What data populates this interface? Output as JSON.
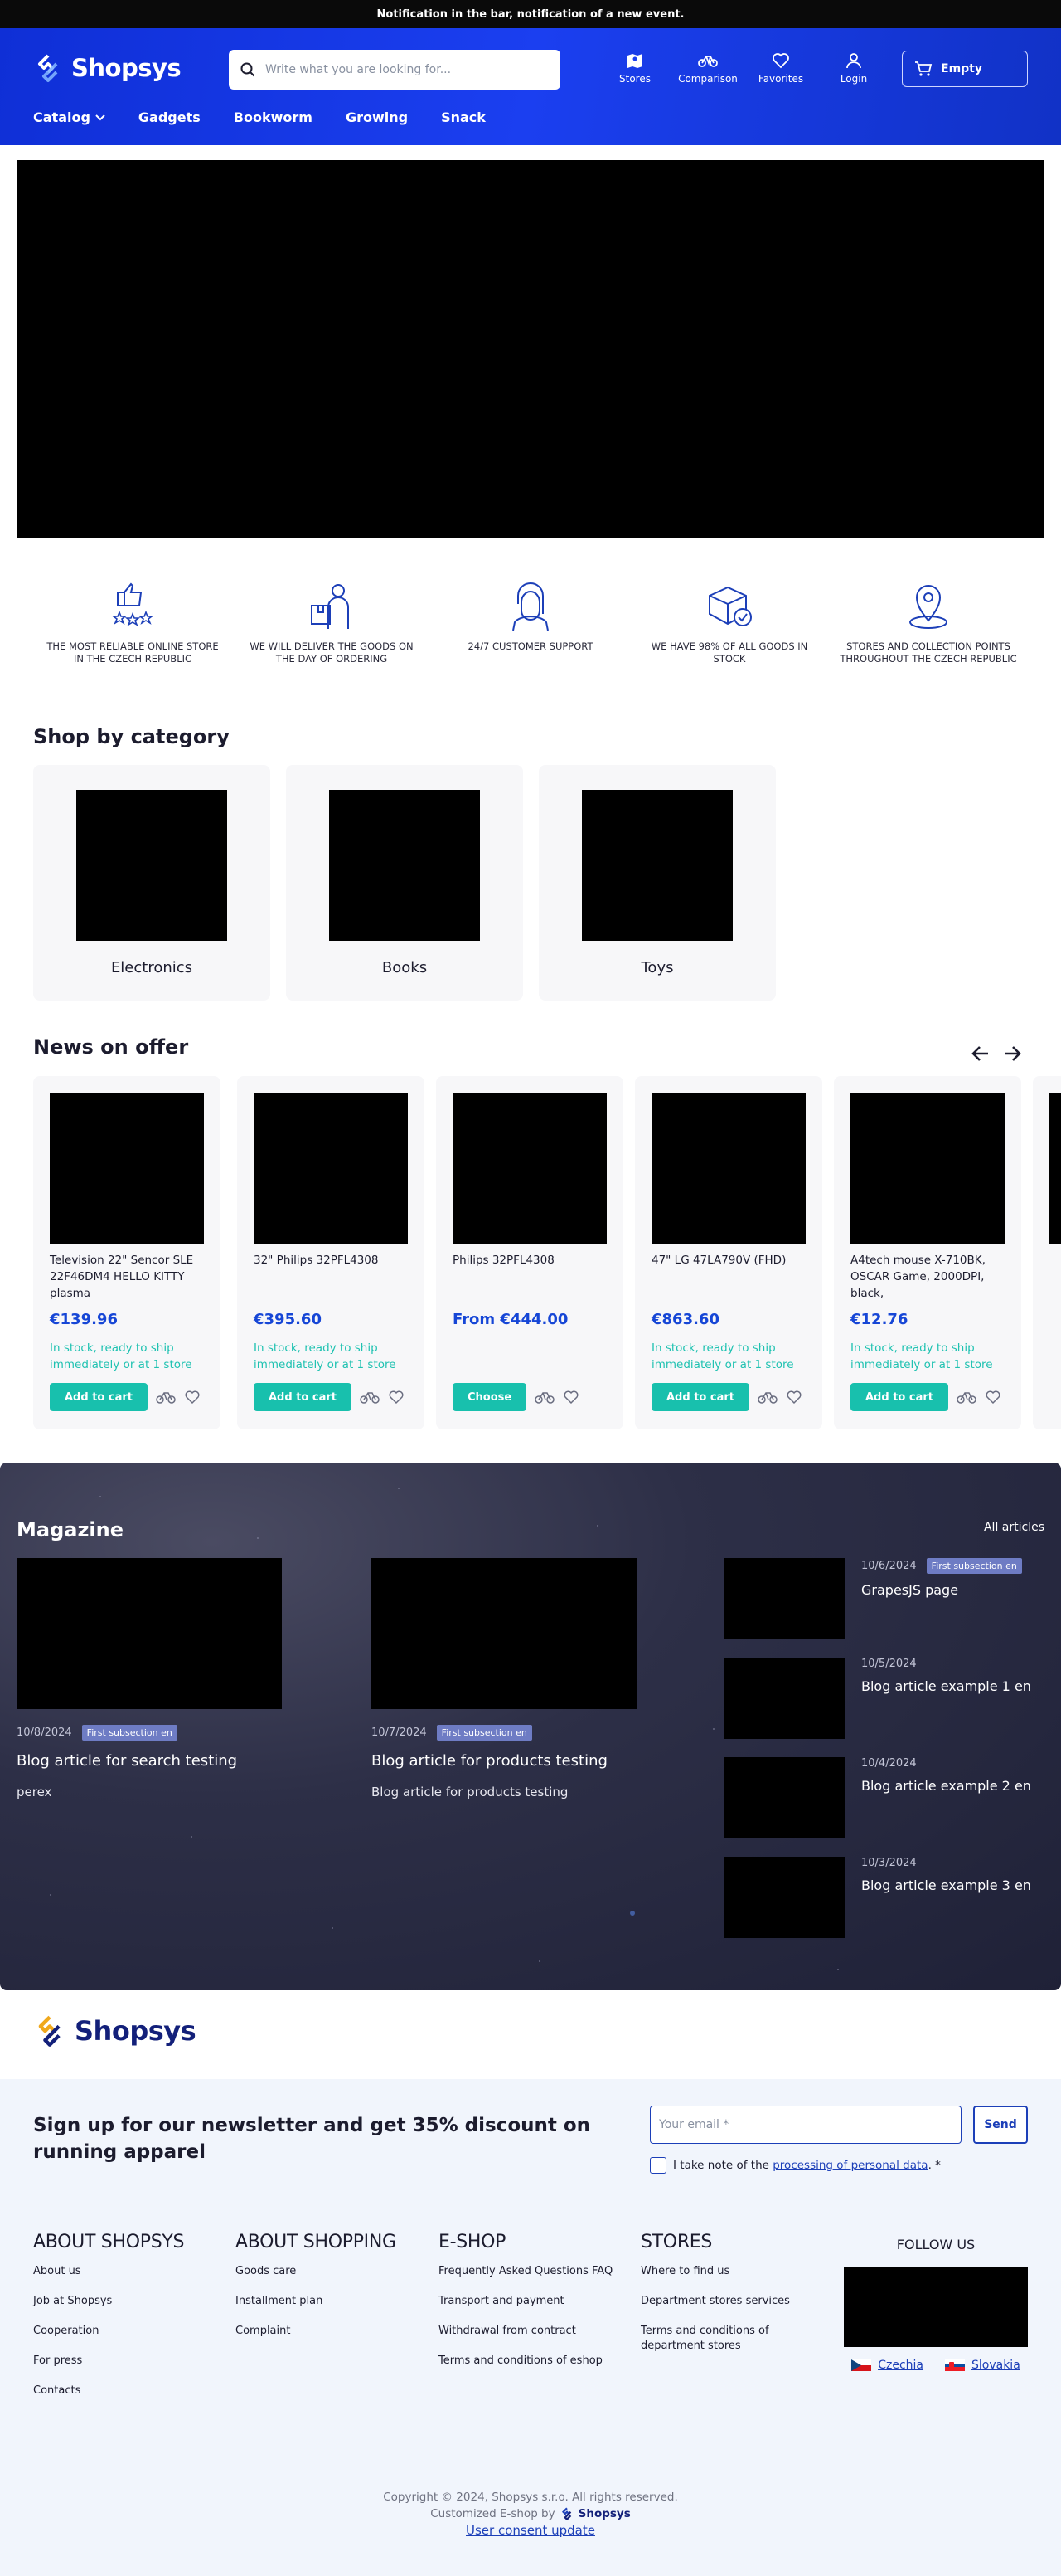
{
  "notification": "Notification in the bar, notification of a new event.",
  "brand": {
    "name": "Shopsys"
  },
  "search": {
    "placeholder": "Write what you are looking for..."
  },
  "header_icons": [
    {
      "label": "Stores",
      "icon": "map-icon"
    },
    {
      "label": "Comparison",
      "icon": "bicycle-icon"
    },
    {
      "label": "Favorites",
      "icon": "heart-icon"
    },
    {
      "label": "Login",
      "icon": "user-icon"
    }
  ],
  "cart": {
    "label": "Empty"
  },
  "nav": [
    "Catalog",
    "Gadgets",
    "Bookworm",
    "Growing",
    "Snack"
  ],
  "usps": [
    "THE MOST RELIABLE ONLINE STORE IN THE CZECH REPUBLIC",
    "WE WILL DELIVER THE GOODS ON THE DAY OF ORDERING",
    "24/7 CUSTOMER SUPPORT",
    "WE HAVE 98% OF ALL GOODS IN STOCK",
    "STORES AND COLLECTION POINTS THROUGHOUT THE CZECH REPUBLIC"
  ],
  "categories": {
    "title": "Shop by category",
    "items": [
      "Electronics",
      "Books",
      "Toys"
    ]
  },
  "products": {
    "title": "News on offer",
    "items": [
      {
        "name": "Television 22\" Sencor SLE 22F46DM4 HELLO KITTY plasma",
        "price": "€139.96",
        "stock": "In stock, ready to ship immediately or at 1 store",
        "button": "Add to cart"
      },
      {
        "name": "32\" Philips 32PFL4308",
        "price": "€395.60",
        "stock": "In stock, ready to ship immediately or at 1 store",
        "button": "Add to cart"
      },
      {
        "name": "Philips 32PFL4308",
        "price": "From €444.00",
        "stock": "",
        "button": "Choose"
      },
      {
        "name": "47\" LG 47LA790V (FHD)",
        "price": "€863.60",
        "stock": "In stock, ready to ship immediately or at 1 store",
        "button": "Add to cart"
      },
      {
        "name": "A4tech mouse X-710BK, OSCAR Game, 2000DPI, black,",
        "price": "€12.76",
        "stock": "In stock, ready to ship immediately or at 1 store",
        "button": "Add to cart"
      }
    ]
  },
  "magazine": {
    "title": "Magazine",
    "all_link": "All articles",
    "big": [
      {
        "date": "10/8/2024",
        "badge": "First subsection en",
        "title": "Blog article for search testing",
        "perex": "perex"
      },
      {
        "date": "10/7/2024",
        "badge": "First subsection en",
        "title": "Blog article for products testing",
        "perex": "Blog article for products testing"
      }
    ],
    "small": [
      {
        "date": "10/6/2024",
        "badge": "First subsection en",
        "title": "GrapesJS page"
      },
      {
        "date": "10/5/2024",
        "badge": "",
        "title": "Blog article example 1 en"
      },
      {
        "date": "10/4/2024",
        "badge": "",
        "title": "Blog article example 2 en"
      },
      {
        "date": "10/3/2024",
        "badge": "",
        "title": "Blog article example 3 en"
      }
    ]
  },
  "newsletter": {
    "title": "Sign up for our newsletter and get 35% discount on running apparel",
    "placeholder": "Your email *",
    "send": "Send",
    "consent_prefix": "I take note of the",
    "consent_link": "processing of personal data",
    "consent_suffix": ". *"
  },
  "footer": {
    "columns": [
      {
        "title": "ABOUT SHOPSYS",
        "links": [
          "About us",
          "Job at Shopsys",
          "Cooperation",
          "For press",
          "Contacts"
        ]
      },
      {
        "title": "ABOUT SHOPPING",
        "links": [
          "Goods care",
          "Installment plan",
          "Complaint"
        ]
      },
      {
        "title": "E-SHOP",
        "links": [
          "Frequently Asked Questions FAQ",
          "Transport and payment",
          "Withdrawal from contract",
          "Terms and conditions of eshop"
        ]
      },
      {
        "title": "STORES",
        "links": [
          "Where to find us",
          "Department stores services",
          "Terms and conditions of department stores"
        ]
      }
    ],
    "follow": "FOLLOW US",
    "languages": [
      "Czechia",
      "Slovakia"
    ],
    "copyright": "Copyright © 2024, Shopsys s.r.o. All rights reserved.",
    "customized": "Customized E-shop by",
    "consent_update": "User consent update"
  },
  "colors": {
    "brand_blue": "#1b3ff0",
    "accent_teal": "#18c0ad",
    "price_blue": "#1646d6",
    "magazine_bg": "#2d2f47"
  }
}
